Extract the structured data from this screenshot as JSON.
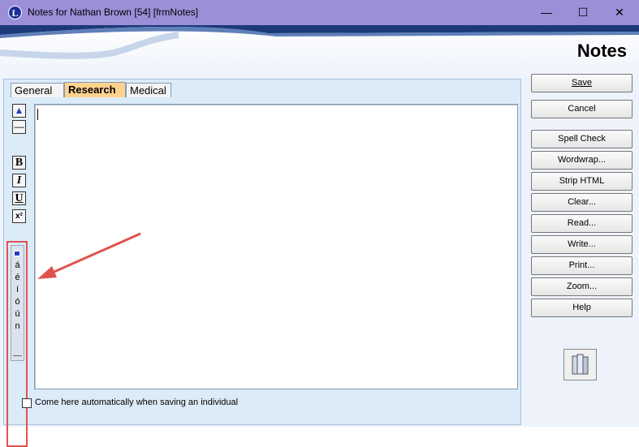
{
  "window": {
    "app_icon": "L",
    "title": "Notes for Nathan Brown [54] [frmNotes]",
    "controls": [
      "minimize-icon",
      "maximize-icon",
      "close-icon"
    ]
  },
  "banner": {
    "title": "Notes"
  },
  "tabs": [
    {
      "label": "General",
      "active": false
    },
    {
      "label": "Research",
      "active": true
    },
    {
      "label": "Medical",
      "active": false
    }
  ],
  "editor": {
    "value": ""
  },
  "format_toolbar": {
    "bold": "B",
    "italic": "I",
    "underline": "U",
    "superscript": "x²"
  },
  "accent_chars": [
    "á",
    "é",
    "í",
    "ó",
    "ú",
    "n"
  ],
  "checkbox": {
    "label": "Come here automatically when saving an individual",
    "checked": false
  },
  "buttons": {
    "save": "Save",
    "cancel": "Cancel",
    "spell_check": "Spell Check",
    "wordwrap": "Wordwrap...",
    "strip_html": "Strip HTML",
    "clear": "Clear...",
    "read": "Read...",
    "write": "Write...",
    "print": "Print...",
    "zoom": "Zoom...",
    "help": "Help"
  },
  "colors": {
    "titlebar": "#9b8fd8",
    "panel": "#dcebf8",
    "active_tab": "#ffd28e",
    "highlight_box": "#e0524f",
    "arrow": "#e0524f",
    "banner_swoosh": "#1b3a7a"
  }
}
